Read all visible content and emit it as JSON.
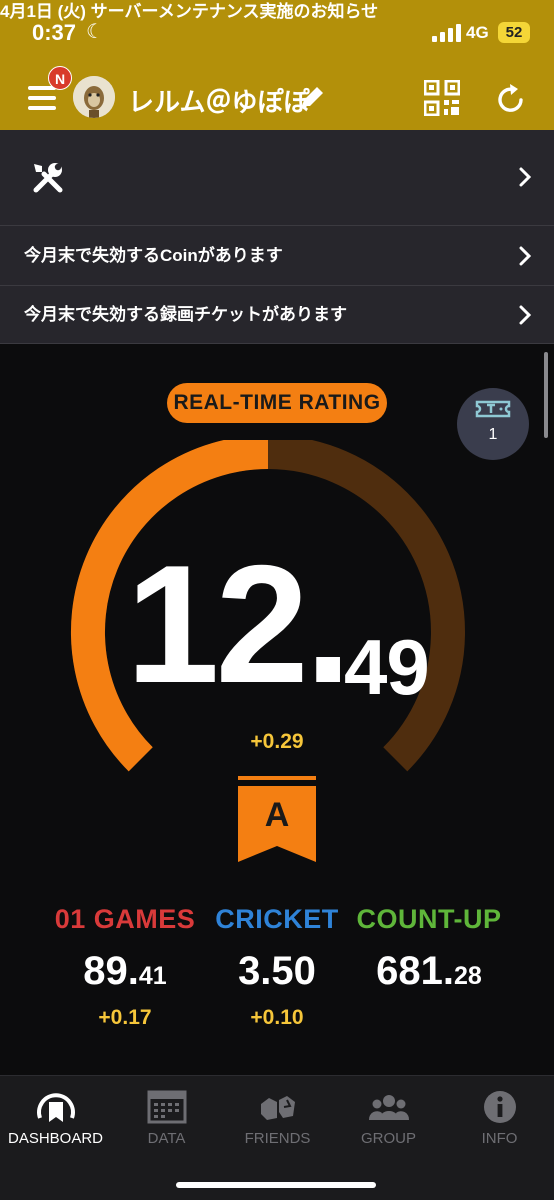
{
  "status_bar": {
    "time": "0:37",
    "network": "4G",
    "battery": "52"
  },
  "header": {
    "notification_badge": "N",
    "username": "レルム＠ゆぽぽ"
  },
  "notices": [
    {
      "text": "4月1日 (火) サーバーメンテナンス実施のお知らせ"
    },
    {
      "text": "今月末で失効するCoinがあります"
    },
    {
      "text": "今月末で失効する録画チケットがあります"
    }
  ],
  "rating": {
    "label": "REAL-TIME RATING",
    "ticket_count": "1",
    "integer": "12.",
    "decimal": "49",
    "value": 12.49,
    "gauge_fill_fraction": 0.5,
    "delta": "+0.29",
    "rank": "A",
    "accent_color": "#f47f12"
  },
  "stats": [
    {
      "title": "01 GAMES",
      "int": "89.",
      "dec": "41",
      "delta": "+0.17",
      "color": "#d93a3a"
    },
    {
      "title": "CRICKET",
      "int": "3.50",
      "dec": "",
      "delta": "+0.10",
      "color": "#2f83d8"
    },
    {
      "title": "COUNT-UP",
      "int": "681.",
      "dec": "28",
      "delta": "",
      "color": "#5fb63a"
    }
  ],
  "tabs": [
    {
      "label": "DASHBOARD",
      "icon": "dashboard-icon",
      "active": true
    },
    {
      "label": "DATA",
      "icon": "data-icon",
      "active": false
    },
    {
      "label": "FRIENDS",
      "icon": "friends-icon",
      "active": false
    },
    {
      "label": "GROUP",
      "icon": "group-icon",
      "active": false
    },
    {
      "label": "INFO",
      "icon": "info-icon",
      "active": false
    }
  ]
}
